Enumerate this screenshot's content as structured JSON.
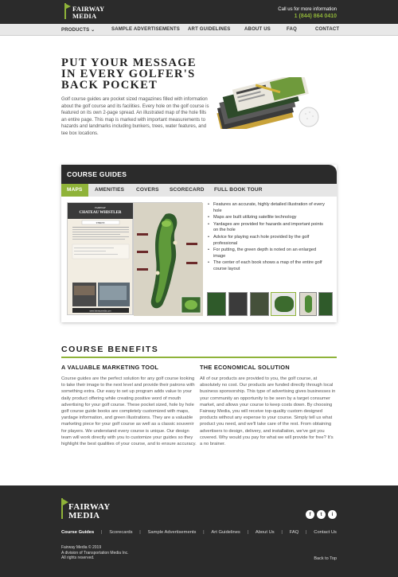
{
  "header": {
    "logo_line1": "FAIRWAY",
    "logo_line2": "MEDIA",
    "contact_label": "Call us for more information",
    "phone": "1 (844) 864 0410"
  },
  "nav": {
    "items": [
      "PRODUCTS",
      "SAMPLE ADVERTISEMENTS",
      "ART GUIDELINES",
      "ABOUT US",
      "FAQ",
      "CONTACT"
    ],
    "products_caret": "⌄"
  },
  "hero": {
    "title": "PUT YOUR MESSAGE IN EVERY GOLFER'S BACK POCKET",
    "text": "Golf course guides are pocket sized magazines filled with information about the golf course and its facilities. Every hole on the golf course is featured on its own 2-page spread. An illustrated map of the hole fills an entire page. This map is marked with important measurements to hazards and landmarks including bunkers, trees, water features, and tee box locations."
  },
  "course_guides": {
    "title": "COURSE GUIDES",
    "tabs": [
      "MAPS",
      "AMENITIES",
      "COVERS",
      "SCORECARD",
      "FULL BOOK TOUR"
    ],
    "active_tab": "MAPS",
    "page_header_small": "FAIRWAY",
    "page_header_name": "CHATEAU WHISTLER",
    "page_hole_label": "THREE",
    "page_url": "www.fairwaymedia.com",
    "bullets": [
      "Features an accurate, highly detailed illustration of every hole",
      "Maps are built utilizing satellite technology",
      "Yardages are provided for hazards and important points on the hole",
      "Advice for playing each hole provided by the golf professional",
      "For putting, the green depth is noted on an enlarged image",
      "The center of each book shows a map of the entire golf course layout"
    ]
  },
  "benefits": {
    "title": "COURSE BENEFITS",
    "col1_title": "A VALUABLE MARKETING TOOL",
    "col1_text": "Course guides are the perfect solution for any golf course looking to take their image to the next level and provide their patrons with something extra. Our easy to set up program adds value to your daily product offering while creating positive word of mouth advertising for your golf course. These pocket sized, hole by hole golf course guide books are completely customized with maps, yardage information, and green illustrations. They are a valuable marketing piece for your golf course as well as a classic souvenir for players. We understand every course is unique. Our design team will work directly with you to customize your guides so they highlight the best qualities of your course, and to ensure accuracy.",
    "col2_title": "THE ECONOMICAL SOLUTION",
    "col2_text": "All of our products are provided to you, the golf course, at absolutely no cost. Our products are funded directly through local business sponsorship. This type of advertising gives businesses in your community an opportunity to be seen by a target consumer market, and allows your course to keep costs down. By choosing Fairway Media, you will receive top-quality custom designed products without any expense to your course. Simply tell us what product you need, and we'll take care of the rest. From obtaining advertisers to design, delivery, and installation, we've got you covered. Why would you pay for what we will provide for free? It's a no brainer."
  },
  "footer": {
    "logo_line1": "FAIRWAY",
    "logo_line2": "MEDIA",
    "links": [
      "Course Guides",
      "Scorecards",
      "Sample Advertisements",
      "Art Guidelines",
      "About Us",
      "FAQ",
      "Contact Us"
    ],
    "separator": "|",
    "social": [
      "f",
      "t",
      "i"
    ],
    "copyright_1": "Fairway Media © 2019",
    "copyright_2": "A division of Transportation Media Inc.",
    "copyright_3": "All rights reserved.",
    "back_to_top": "Back to Top"
  },
  "colors": {
    "accent": "#8fb339",
    "dark": "#2b2b2b"
  }
}
